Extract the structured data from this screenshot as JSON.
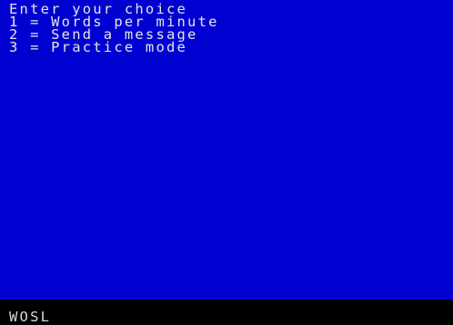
{
  "screen": {
    "background_color": "#0000d0",
    "text_color": "#e6e6e6",
    "prompt": "Enter your choice",
    "options": [
      "1 = Words per minute",
      "2 = Send a message",
      "3 = Practice mode"
    ]
  },
  "status_bar": {
    "background_color": "#000000",
    "text": "WOSL"
  }
}
